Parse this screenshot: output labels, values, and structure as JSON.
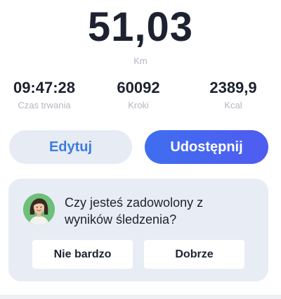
{
  "summary": {
    "distance": "51,03",
    "distance_unit": "Km"
  },
  "stats": [
    {
      "value": "09:47:28",
      "label": "Czas trwania"
    },
    {
      "value": "60092",
      "label": "Kroki"
    },
    {
      "value": "2389,9",
      "label": "Kcal"
    }
  ],
  "actions": {
    "edit_label": "Edytuj",
    "share_label": "Udostępnij"
  },
  "feedback": {
    "question": "Czy jesteś zadowolony z wyników śledzenia?",
    "option_negative": "Nie bardzo",
    "option_positive": "Dobrze"
  },
  "colors": {
    "accent": "#4f5cf0",
    "edit_text": "#3f7ddb",
    "card_bg": "#e8ecf4"
  }
}
